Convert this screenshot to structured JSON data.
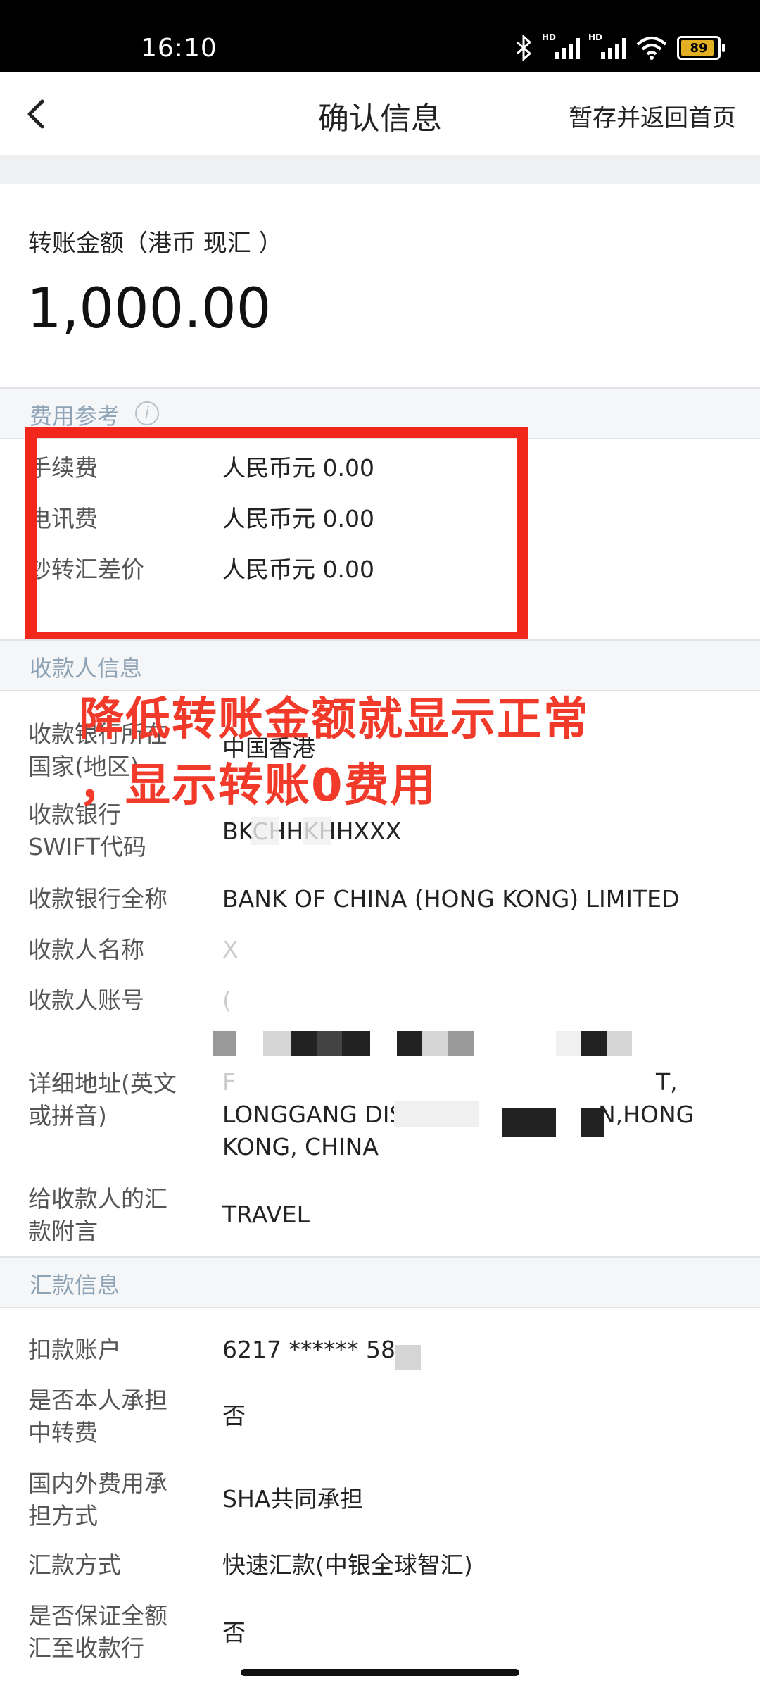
{
  "status": {
    "time": "16:10",
    "battery": "89",
    "hd": "HD"
  },
  "nav": {
    "title": "确认信息",
    "action": "暂存并返回首页"
  },
  "amount": {
    "label": "转账金额（港币 现汇 ）",
    "value": "1,000.00"
  },
  "fees": {
    "header": "费用参考",
    "rows": [
      {
        "label": "手续费",
        "value": "人民币元 0.00"
      },
      {
        "label": "电讯费",
        "value": "人民币元 0.00"
      },
      {
        "label": "钞转汇差价",
        "value": "人民币元 0.00"
      }
    ]
  },
  "payee": {
    "header": "收款人信息",
    "country_label": "收款银行所在国家(地区)",
    "country_value": "中国香港",
    "swift_label": "收款银行SWIFT代码",
    "swift_value": "BKCHHKHHXXX",
    "bank_name_label": "收款银行全称",
    "bank_name_value": "BANK OF CHINA (HONG KONG) LIMITED",
    "name_label": "收款人名称",
    "name_value": "X",
    "account_label": "收款人账号",
    "account_value": "(",
    "address_label": "详细地址(英文或拼音)",
    "address_line1_start": "F",
    "address_line1_end": "T,",
    "address_line2_start": "LONGGANG DIS",
    "address_line2_end": "N,HONG",
    "address_line3": "KONG, CHINA",
    "remark_label": "给收款人的汇款附言",
    "remark_value": "TRAVEL"
  },
  "remit": {
    "header": "汇款信息",
    "debit_label": "扣款账户",
    "debit_value": "6217 ****** 58",
    "self_bear_label": "是否本人承担中转费",
    "self_bear_value": "否",
    "fee_mode_label": "国内外费用承担方式",
    "fee_mode_value": "SHA共同承担",
    "method_label": "汇款方式",
    "method_value": "快速汇款(中银全球智汇)",
    "guarantee_label": "是否保证全额汇至收款行",
    "guarantee_value": "否"
  },
  "annotation": {
    "line1": "降低转账金额就显示正常",
    "line2": "，显示转账0费用"
  },
  "colors": {
    "annotation": "#f23a2a",
    "section_text": "#8ea3b5",
    "battery": "#e3b024"
  }
}
